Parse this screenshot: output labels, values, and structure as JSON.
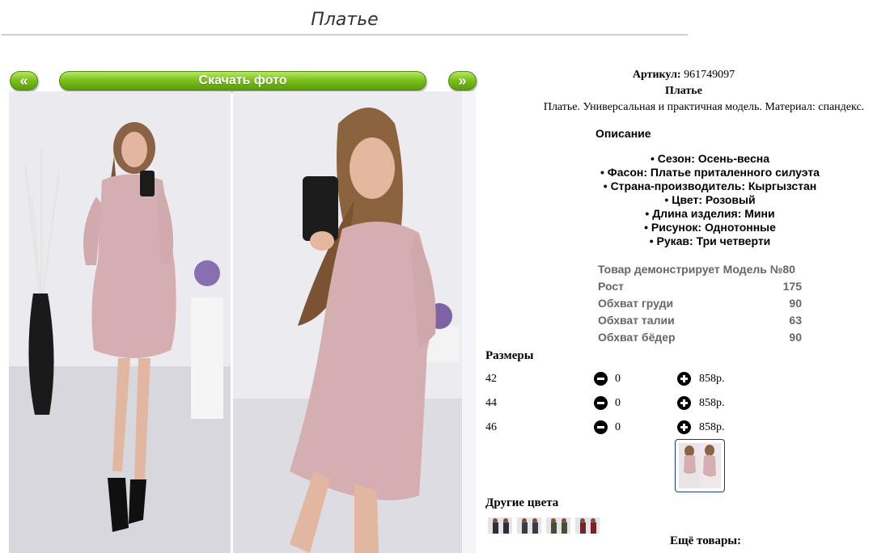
{
  "page": {
    "title": "Платье"
  },
  "nav": {
    "prev_label": "«",
    "download_label": "Скачать фото",
    "next_label": "»"
  },
  "product": {
    "article_label": "Артикул:",
    "article_value": "961749097",
    "name": "Платье",
    "short_description": "Платье. Универсальная и практичная модель. Материал: спандекс."
  },
  "description": {
    "heading": "Описание",
    "properties": [
      "• Сезон: Осень-весна",
      "• Фасон: Платье приталенного силуэта",
      "• Страна-производитель: Кыргызстан",
      "• Цвет: Розовый",
      "• Длина изделия: Мини",
      "• Рисунок: Однотонные",
      "• Рукав: Три четверти"
    ]
  },
  "model": {
    "heading": "Товар демонстрирует Модель №80",
    "rows": [
      {
        "label": "Рост",
        "value": "175"
      },
      {
        "label": "Обхват груди",
        "value": "90"
      },
      {
        "label": "Обхват талии",
        "value": "63"
      },
      {
        "label": "Обхват бёдер",
        "value": "90"
      }
    ]
  },
  "sizes": {
    "heading": "Размеры",
    "rows": [
      {
        "size": "42",
        "qty": "0",
        "price": "858р."
      },
      {
        "size": "44",
        "qty": "0",
        "price": "858р."
      },
      {
        "size": "46",
        "qty": "0",
        "price": "858р."
      }
    ]
  },
  "other_colors": {
    "heading": "Другие цвета",
    "count": 4
  },
  "more_products": {
    "heading": "Ещё товары:"
  },
  "colors": {
    "button_green": "#7cc21c",
    "dress_pink": "#d4aeb0",
    "thumb_border": "#1c3c78"
  },
  "icons": {
    "minus": "minus-circle-icon",
    "plus": "plus-circle-icon"
  }
}
